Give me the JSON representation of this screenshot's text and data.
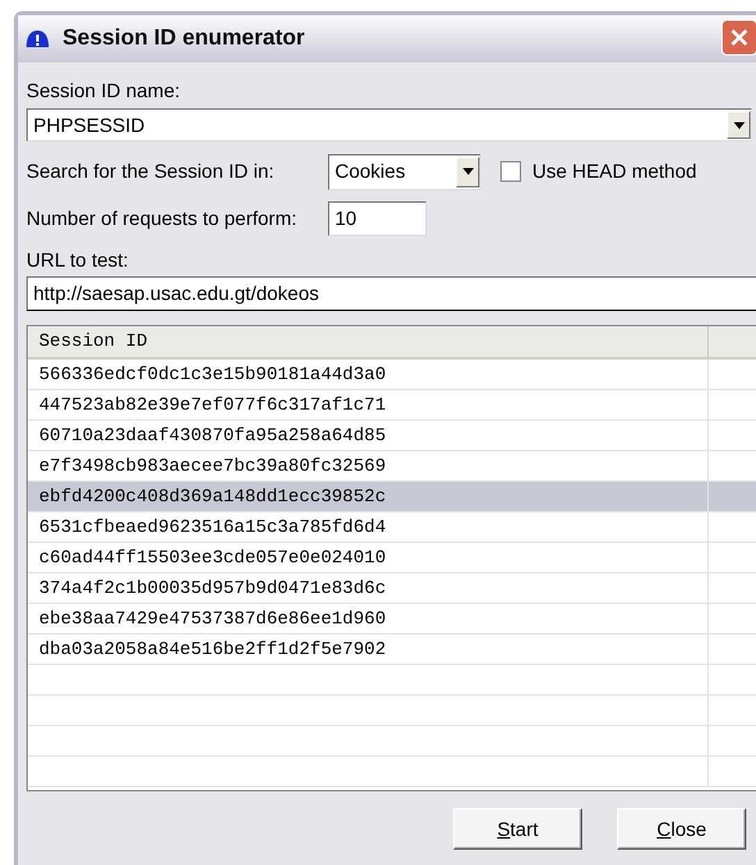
{
  "window": {
    "title": "Session ID enumerator"
  },
  "session_name": {
    "label": "Session ID name:",
    "value": "PHPSESSID"
  },
  "search_in": {
    "label": "Search for the Session ID in:",
    "value": "Cookies"
  },
  "use_head": {
    "label": "Use HEAD method",
    "checked": false
  },
  "requests": {
    "label": "Number of requests to perform:",
    "value": "10"
  },
  "url": {
    "label": "URL to test:",
    "value": "http://saesap.usac.edu.gt/dokeos"
  },
  "table": {
    "columns": [
      "Session ID"
    ],
    "rows": [
      {
        "id": "566336edcf0dc1c3e15b90181a44d3a0",
        "selected": false
      },
      {
        "id": "447523ab82e39e7ef077f6c317af1c71",
        "selected": false
      },
      {
        "id": "60710a23daaf430870fa95a258a64d85",
        "selected": false
      },
      {
        "id": "e7f3498cb983aecee7bc39a80fc32569",
        "selected": false
      },
      {
        "id": "ebfd4200c408d369a148dd1ecc39852c",
        "selected": true
      },
      {
        "id": "6531cfbeaed9623516a15c3a785fd6d4",
        "selected": false
      },
      {
        "id": "c60ad44ff15503ee3cde057e0e024010",
        "selected": false
      },
      {
        "id": "374a4f2c1b00035d957b9d0471e83d6c",
        "selected": false
      },
      {
        "id": "ebe38aa7429e47537387d6e86ee1d960",
        "selected": false
      },
      {
        "id": "dba03a2058a84e516be2ff1d2f5e7902",
        "selected": false
      }
    ]
  },
  "buttons": [
    {
      "label": "Start",
      "first_letter_underlined": true
    },
    {
      "label": "Close",
      "first_letter_underlined": true
    }
  ]
}
